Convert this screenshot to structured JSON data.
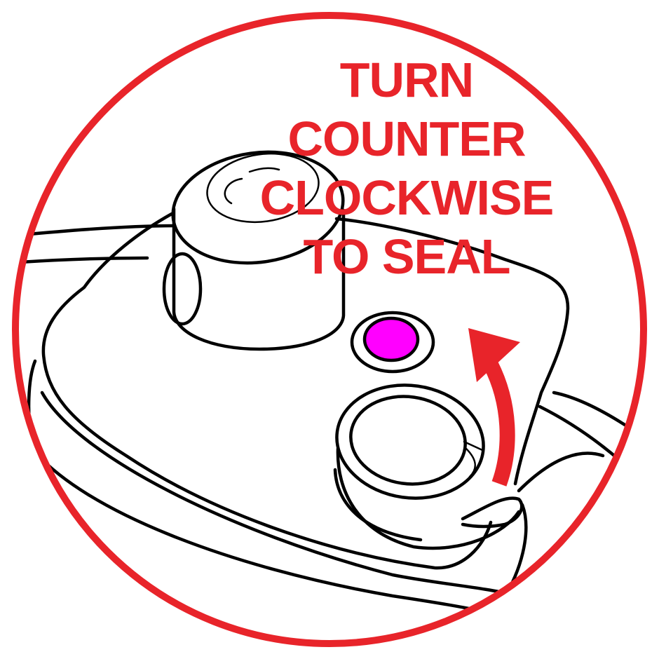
{
  "instruction": {
    "lines": [
      "TURN",
      "COUNTER",
      "CLOCKWISE",
      "TO SEAL"
    ]
  },
  "colors": {
    "accent": "#e8242a",
    "indicator": "#ff00ff",
    "ink": "#000000",
    "background": "#ffffff"
  },
  "icons": {
    "direction": "counter-clockwise-arrow-icon",
    "indicator": "float-valve-indicator-icon"
  }
}
